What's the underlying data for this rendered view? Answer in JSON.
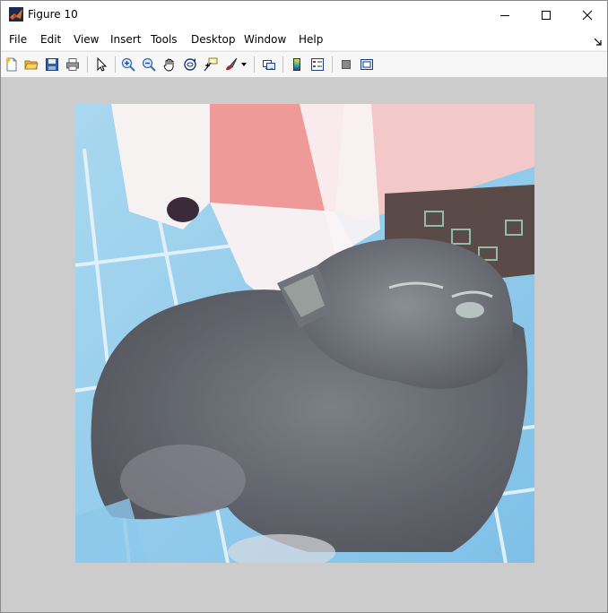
{
  "window": {
    "title": "Figure 10"
  },
  "menu": [
    "File",
    "Edit",
    "View",
    "Insert",
    "Tools",
    "Desktop",
    "Window",
    "Help"
  ],
  "toolbar": {
    "icons": [
      "new-figure-icon",
      "open-file-icon",
      "save-icon",
      "print-icon",
      "edit-plot-arrow-icon",
      "zoom-in-icon",
      "zoom-out-icon",
      "pan-hand-icon",
      "rotate-3d-icon",
      "data-cursor-icon",
      "brush-icon",
      "link-plot-icon",
      "colorbar-icon",
      "legend-icon",
      "hide-plot-tools-icon",
      "show-plot-tools-icon"
    ]
  },
  "colors": {
    "titlebar": "#ffffff",
    "canvas": "#cccccc",
    "matlab_orange": "#e07020"
  }
}
